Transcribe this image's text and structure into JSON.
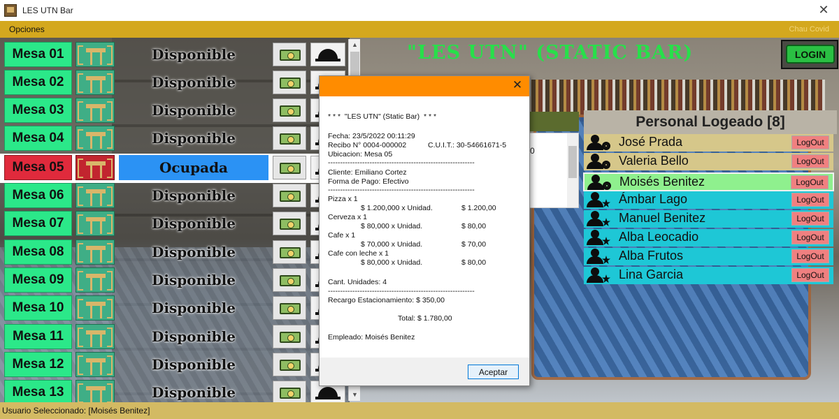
{
  "window": {
    "title": "LES UTN Bar"
  },
  "menu": {
    "opciones": "Opciones",
    "slogan": "Chau Covid"
  },
  "header": {
    "bar_title": "\"LES UTN\" (STATIC BAR)",
    "login_label": "LOGIN"
  },
  "tables": [
    {
      "name": "Mesa 01",
      "status": "Disponible",
      "ocupada": false
    },
    {
      "name": "Mesa 02",
      "status": "Disponible",
      "ocupada": false
    },
    {
      "name": "Mesa 03",
      "status": "Disponible",
      "ocupada": false
    },
    {
      "name": "Mesa 04",
      "status": "Disponible",
      "ocupada": false
    },
    {
      "name": "Mesa 05",
      "status": "Ocupada",
      "ocupada": true
    },
    {
      "name": "Mesa 06",
      "status": "Disponible",
      "ocupada": false
    },
    {
      "name": "Mesa 07",
      "status": "Disponible",
      "ocupada": false
    },
    {
      "name": "Mesa 08",
      "status": "Disponible",
      "ocupada": false
    },
    {
      "name": "Mesa 09",
      "status": "Disponible",
      "ocupada": false
    },
    {
      "name": "Mesa 10",
      "status": "Disponible",
      "ocupada": false
    },
    {
      "name": "Mesa 11",
      "status": "Disponible",
      "ocupada": false
    },
    {
      "name": "Mesa 12",
      "status": "Disponible",
      "ocupada": false
    },
    {
      "name": "Mesa 13",
      "status": "Disponible",
      "ocupada": false
    }
  ],
  "personal": {
    "title": "Personal Logeado [8]",
    "logout_label": "LogOut",
    "employees": [
      {
        "name": "José Prada",
        "style": "gold",
        "icon": "person-gear-icon"
      },
      {
        "name": "Valeria Bello",
        "style": "gold",
        "icon": "person-gear-icon"
      },
      {
        "name": "Moisés Benitez",
        "style": "sel",
        "icon": "person-gear-icon"
      },
      {
        "name": "Ámbar Lago",
        "style": "cyan",
        "icon": "person-star-icon"
      },
      {
        "name": "Manuel Benitez",
        "style": "cyan",
        "icon": "person-star-icon"
      },
      {
        "name": "Alba Leocadio",
        "style": "cyan",
        "icon": "person-star-icon"
      },
      {
        "name": "Alba Frutos",
        "style": "cyan",
        "icon": "person-star-icon"
      },
      {
        "name": "Lina Garcia",
        "style": "cyan",
        "icon": "person-star-icon"
      }
    ]
  },
  "hidden_panel": {
    "partial_value": "0"
  },
  "receipt": {
    "header": "* * *  \"LES UTN\" (Static Bar)  * * *",
    "fecha": "Fecha: 23/5/2022 00:11:29",
    "recibo": "Recibo N° 0004-000002",
    "cuit": "C.U.I.T.: 30-54661671-5",
    "ubicacion": "Ubicacion: Mesa 05",
    "separator": "------------------------------------------------------------",
    "cliente": "Cliente: Emiliano Cortez",
    "forma_pago": "Forma de Pago: Efectivo",
    "items": [
      {
        "title": "Pizza x 1",
        "unit": "$ 1.200,000 x Unidad.",
        "total": "$ 1.200,00"
      },
      {
        "title": "Cerveza x 1",
        "unit": "$ 80,000 x Unidad.",
        "total": "$ 80,00"
      },
      {
        "title": "Cafe x 1",
        "unit": "$ 70,000 x Unidad.",
        "total": "$ 70,00"
      },
      {
        "title": "Cafe con leche x 1",
        "unit": "$ 80,000 x Unidad.",
        "total": "$ 80,00"
      }
    ],
    "cant_unidades": "Cant. Unidades: 4",
    "recargo": "Recargo Estacionamiento: $ 350,00",
    "total": "Total: $ 1.780,00",
    "empleado": "Empleado: Moisés Benitez",
    "aceptar_label": "Aceptar"
  },
  "status": {
    "text": "Usuario Seleccionado: [Moisés Benitez]"
  },
  "colors": {
    "menu_bar": "#d4a81e",
    "mesa_free": "#2be889",
    "mesa_busy": "#e02a3c",
    "estado_busy": "#2b92f4",
    "title_green": "#27e04a",
    "dialog_header": "#ff8c00",
    "logout": "#f08080"
  }
}
